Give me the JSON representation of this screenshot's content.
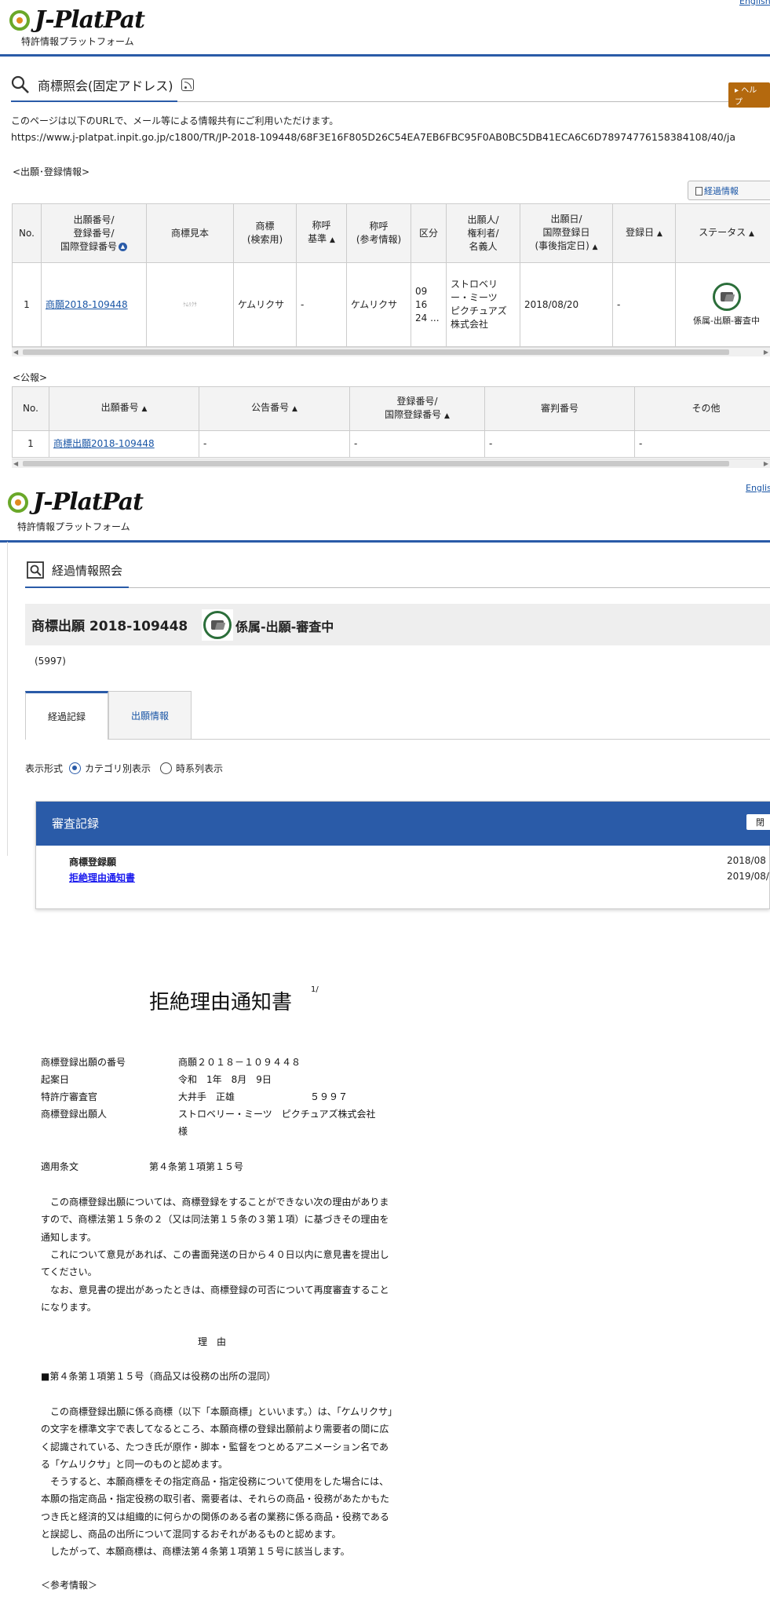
{
  "header": {
    "logo_text": "J-PlatPat",
    "logo_subtitle": "特許情報プラットフォーム",
    "lang_link": "English",
    "lang_link_2": "Englis"
  },
  "detail_page": {
    "title": "商標照会(固定アドレス)",
    "help_label": "▸ ヘルプ",
    "share_note": "このページは以下のURLで、メール等による情報共有にご利用いただけます。",
    "fixed_url": "https://www.j-platpat.inpit.go.jp/c1800/TR/JP-2018-109448/68F3E16F805D26C54EA7EB6FBC95F0AB0BC5DB41ECA6C6D78974776158384108/40/ja",
    "app_section_label": "<出願･登録情報>",
    "progress_button": "経過情報",
    "app_table": {
      "headers": [
        "No.",
        "出願番号/\n登録番号/\n国際登録番号",
        "商標見本",
        "商標\n(検索用)",
        "称呼\n基準",
        "称呼\n(参考情報)",
        "区分",
        "出願人/\n権利者/\n名義人",
        "出願日/\n国際登録日\n(事後指定日)",
        "登録日",
        "ステータス"
      ],
      "row": {
        "no": "1",
        "app_number": "商願2018-109448",
        "sample": "ｹﾑﾘｸｻ",
        "trademark": "ケムリクサ",
        "reading_basis": "-",
        "reading": "ケムリクサ",
        "classes": "09\n16\n24 ...",
        "applicant": "ストロベリ\nー・ミーツ\nピクチュアズ\n株式会社",
        "app_date": "2018/08/20",
        "reg_date": "-",
        "status": "係属-出願-審査中"
      }
    },
    "pub_section_label": "<公報>",
    "pub_table": {
      "headers": [
        "No.",
        "出願番号",
        "公告番号",
        "登録番号/\n国際登録番号",
        "審判番号",
        "その他"
      ],
      "row": {
        "no": "1",
        "app_number": "商標出願2018-109448",
        "pub_no": "-",
        "reg_no": "-",
        "trial_no": "-",
        "other": "-"
      }
    }
  },
  "progress_page": {
    "title": "経過情報照会",
    "case_title": "商標出願 2018-109448",
    "case_status": "係属-出願-審査中",
    "examiner_code": "(5997)",
    "tabs": [
      "経過記録",
      "出願情報"
    ],
    "display_label": "表示形式",
    "display_options": [
      "カテゴリ別表示",
      "時系列表示"
    ],
    "panel_title": "審査記録",
    "close_label": "閉",
    "records": [
      {
        "name": "商標登録願",
        "date": "2018/08"
      },
      {
        "name": "拒絶理由通知書",
        "date": "2019/08/"
      }
    ]
  },
  "document": {
    "page_mark": "1/",
    "title": "拒絶理由通知書",
    "fields": [
      {
        "label": "商標登録出願の番号",
        "value": "商願２０１８－１０９４４８"
      },
      {
        "label": "起案日",
        "value": "令和　1年　8月　9日"
      },
      {
        "label": "特許庁審査官",
        "value": "大井手　正雄　　　　　　　　５９９７"
      },
      {
        "label": "商標登録出願人",
        "value": "ストロベリー・ミーツ　ピクチュアズ株式会社"
      }
    ],
    "applicant_suffix": "様",
    "applied_label": "適用条文",
    "applied_value": "第４条第１項第１５号",
    "intro_paragraphs": [
      "この商標登録出願については、商標登録をすることができない次の理由がありますので、商標法第１５条の２（又は同法第１５条の３第１項）に基づきその理由を通知します。",
      "これについて意見があれば、この書面発送の日から４０日以内に意見書を提出してください。",
      "なお、意見書の提出があったときは、商標登録の可否について再度審査することになります。"
    ],
    "reason_heading": "理　由",
    "reason_item": "■第４条第１項第１５号（商品又は役務の出所の混同）",
    "reason_paragraphs": [
      "この商標登録出願に係る商標（以下「本願商標」といいます。）は、「ケムリクサ」の文字を標準文字で表してなるところ、本願商標の登録出願前より需要者の間に広く認識されている、たつき氏が原作・脚本・監督をつとめるアニメーション名である「ケムリクサ」と同一のものと認めます。",
      "そうすると、本願商標をその指定商品・指定役務について使用をした場合には、本願の指定商品・指定役務の取引者、需要者は、それらの商品・役務があたかもたつき氏と経済的又は組織的に何らかの関係のある者の業務に係る商品・役務であると誤認し、商品の出所について混同するおそれがあるものと認めます。",
      "したがって、本願商標は、商標法第４条第１項第１５号に該当します。"
    ],
    "trailing_label": "＜参考情報＞"
  }
}
